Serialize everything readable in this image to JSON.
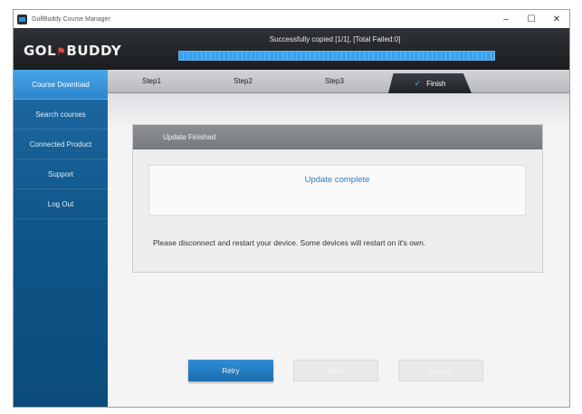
{
  "window": {
    "title": "GolfBuddy Course Manager",
    "minimize": "–",
    "maximize": "☐",
    "close": "✕"
  },
  "header": {
    "logo_left": "GOL",
    "logo_flag": "⚑",
    "logo_right": "BUDDY",
    "status": "Successfully copied [1/1], [Total Failed:0]",
    "progress": 1.0
  },
  "sidebar": {
    "items": [
      {
        "label": "Course Download",
        "active": true
      },
      {
        "label": "Search courses"
      },
      {
        "label": "Connected Product"
      },
      {
        "label": "Support"
      },
      {
        "label": "Log Out"
      }
    ]
  },
  "steps": [
    {
      "label": "Step1"
    },
    {
      "label": "Step2"
    },
    {
      "label": "Step3"
    },
    {
      "label": "Finish",
      "icon": "check-icon",
      "check": "✓"
    }
  ],
  "panel": {
    "title": "Update Finished",
    "message": "Update complete",
    "note": "Please disconnect and restart your device. Some devices will restart on it's own."
  },
  "buttons": {
    "retry": "Retry",
    "next": "Next",
    "cancel": "Cancel"
  },
  "colors": {
    "accent": "#2a8fd8",
    "sidebar": "#0f5588",
    "header": "#1b1d20"
  }
}
